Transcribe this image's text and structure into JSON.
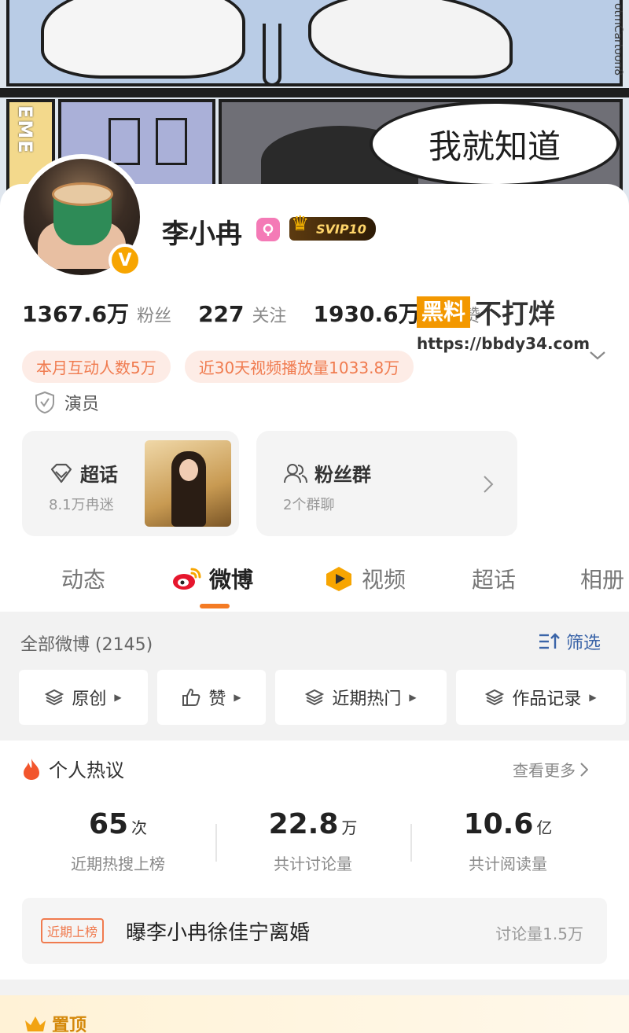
{
  "banner": {
    "speech_bubble": "我就知道",
    "credit": "otmCartoon8",
    "side_text": "EME"
  },
  "profile": {
    "name": "李小冉",
    "vip_label": "SVIP10",
    "verified_mark": "V"
  },
  "stats": [
    {
      "value": "1367.6万",
      "label": "粉丝"
    },
    {
      "value": "227",
      "label": "关注"
    },
    {
      "value": "1930.6万",
      "label": "转评赞"
    }
  ],
  "watermark": {
    "badge": "黑料",
    "text": "不打烊",
    "url": "https://bbdy34.com"
  },
  "tags": [
    "本月互动人数5万",
    "近30天视频播放量1033.8万"
  ],
  "role": "演员",
  "features": {
    "super_topic": {
      "title": "超话",
      "subtitle": "8.1万冉迷"
    },
    "fan_group": {
      "title": "粉丝群",
      "subtitle": "2个群聊"
    }
  },
  "tabs": [
    "动态",
    "微博",
    "视频",
    "超话",
    "相册"
  ],
  "feed": {
    "count_label": "全部微博 (2145)",
    "filter_label": "筛选",
    "chips": [
      "原创",
      "赞",
      "近期热门",
      "作品记录"
    ]
  },
  "hot": {
    "title": "个人热议",
    "more": "查看更多",
    "metrics": [
      {
        "value": "65",
        "unit": "次",
        "label": "近期热搜上榜"
      },
      {
        "value": "22.8",
        "unit": "万",
        "label": "共计讨论量"
      },
      {
        "value": "10.6",
        "unit": "亿",
        "label": "共计阅读量"
      }
    ],
    "item": {
      "badge": "近期上榜",
      "text": "曝李小冉徐佳宁离婚",
      "discussion": "讨论量1.5万"
    }
  },
  "pinned": {
    "label": "置顶"
  },
  "colors": {
    "accent": "#f47b24",
    "tag_text": "#f07b4f",
    "link": "#3a64a8",
    "vip_gold": "#ffd56a"
  }
}
